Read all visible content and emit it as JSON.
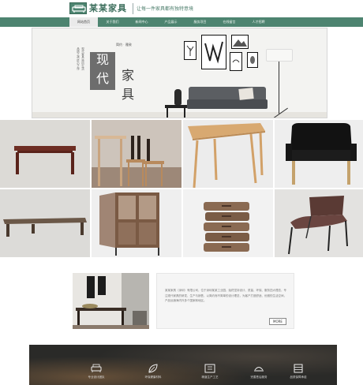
{
  "header": {
    "brand_name": "某某家具",
    "slogan": "让每一件家具都有独特意境",
    "logo_icon": "armchair-icon"
  },
  "nav": {
    "items": [
      {
        "label": "网站首页",
        "active": true
      },
      {
        "label": "关于我们",
        "active": false
      },
      {
        "label": "新闻中心",
        "active": false
      },
      {
        "label": "产品展示",
        "active": false
      },
      {
        "label": "服务项目",
        "active": false
      },
      {
        "label": "在线留言",
        "active": false
      },
      {
        "label": "人才招聘",
        "active": false
      }
    ]
  },
  "banner": {
    "headline_chars": [
      "现",
      "代"
    ],
    "headline_chars_2": [
      "家",
      "具"
    ],
    "tagline": "简约 · 雅致",
    "poem_lines": [
      "现代家具 简约生活",
      "品质之选 匠心之作"
    ]
  },
  "products": [
    {
      "name": "red-wood-bench",
      "icon": "bench-icon"
    },
    {
      "name": "bar-stools",
      "icon": "stool-icon"
    },
    {
      "name": "wooden-desk",
      "icon": "desk-icon"
    },
    {
      "name": "leather-armchair",
      "icon": "armchair-icon"
    },
    {
      "name": "low-coffee-table",
      "icon": "table-icon"
    },
    {
      "name": "glass-cabinet",
      "icon": "cabinet-icon"
    },
    {
      "name": "drawer-chest",
      "icon": "drawers-icon"
    },
    {
      "name": "lounge-chair",
      "icon": "chair-icon"
    }
  ],
  "about": {
    "text": "某某家具（深圳）有限公司，位于深圳某某工业园，始终坚持设计、质量、环保、服务四大理念，专注现代家具的研发、生产与销售，以简约而不简单的设计理念，为客户打造舒适、优雅的生活空间，产品远销海内外多个国家和地区。",
    "more_label": "MORE"
  },
  "features": [
    {
      "label": "专业设计团队",
      "icon": "sofa-icon"
    },
    {
      "label": "环保健康材料",
      "icon": "leaf-icon"
    },
    {
      "label": "精湛生产工艺",
      "icon": "tools-icon"
    },
    {
      "label": "完善售后服务",
      "icon": "service-icon"
    },
    {
      "label": "品质保障承诺",
      "icon": "cabinet-icon"
    }
  ],
  "colors": {
    "brand": "#4d8470",
    "nav_active": "#eaeaea"
  }
}
